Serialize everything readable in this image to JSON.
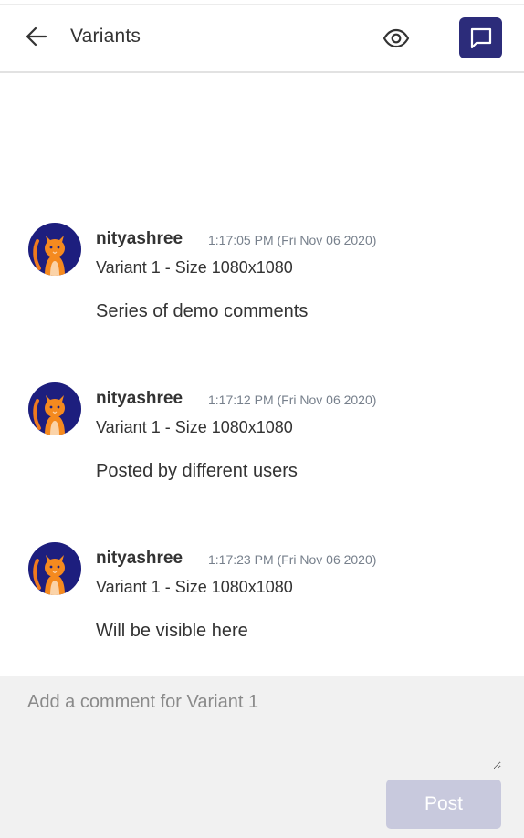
{
  "header": {
    "back_icon": "arrow-left-icon",
    "title": "Variants",
    "preview_icon": "eye-icon",
    "comments_icon": "chat-bubble-icon"
  },
  "colors": {
    "accent": "#2c2c7a",
    "post_button_disabled": "#c8c9dd",
    "composer_background": "#f1f1f1",
    "timestamp": "#77808c"
  },
  "comments": [
    {
      "user": "nityashree",
      "time": "1:17:05 PM (Fri Nov 06 2020)",
      "variant": "Variant 1 - Size 1080x1080",
      "text": "Series of demo comments"
    },
    {
      "user": "nityashree",
      "time": "1:17:12 PM (Fri Nov 06 2020)",
      "variant": "Variant 1 - Size 1080x1080",
      "text": "Posted by different users"
    },
    {
      "user": "nityashree",
      "time": "1:17:23 PM (Fri Nov 06 2020)",
      "variant": "Variant 1 - Size 1080x1080",
      "text": "Will be visible here"
    }
  ],
  "composer": {
    "placeholder": "Add a comment for Variant 1",
    "value": "",
    "post_label": "Post"
  }
}
